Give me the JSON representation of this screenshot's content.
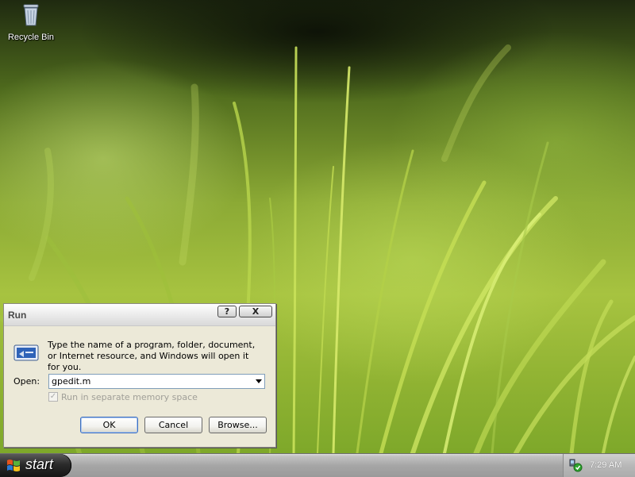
{
  "desktop": {
    "icons": [
      {
        "label": "Recycle Bin",
        "icon": "recycle-bin-icon"
      }
    ]
  },
  "run_dialog": {
    "title": "Run",
    "help_button": "?",
    "close_button": "X",
    "description": "Type the name of a program, folder, document, or Internet resource, and Windows will open it for you.",
    "open_label": "Open:",
    "open_value": "gpedit.m",
    "checkbox_label": "Run in separate memory space",
    "checkbox_checked": true,
    "checkbox_enabled": false,
    "ok_label": "OK",
    "cancel_label": "Cancel",
    "browse_label": "Browse..."
  },
  "taskbar": {
    "start_label": "start",
    "clock": "7:29 AM",
    "tray_icons": [
      "network-icon"
    ]
  }
}
